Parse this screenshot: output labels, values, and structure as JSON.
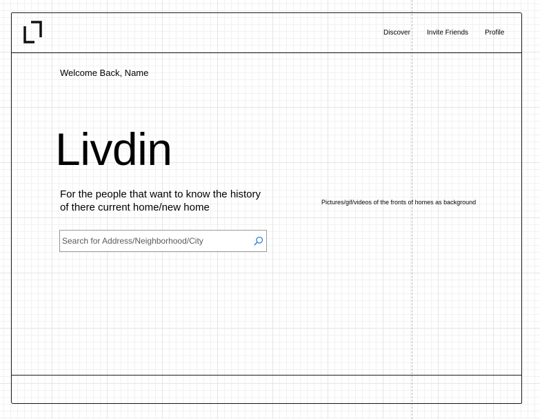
{
  "header": {
    "logo_icon": "bracket-logo-icon",
    "nav": {
      "discover": "Discover",
      "invite_friends": "Invite Friends",
      "profile": "Profile"
    }
  },
  "main": {
    "welcome": "Welcome Back, Name",
    "brand": "Livdin",
    "tagline": "For the people that want to know the history of there current home/new home",
    "background_note": "Pictures/gif/videos of the fronts of homes as background",
    "search": {
      "placeholder": "Search for Address/Neighborhood/City",
      "icon": "search-icon"
    }
  },
  "colors": {
    "accent": "#2f7fd0",
    "stroke": "#1a1a1a",
    "grid": "#e4e4e4"
  }
}
